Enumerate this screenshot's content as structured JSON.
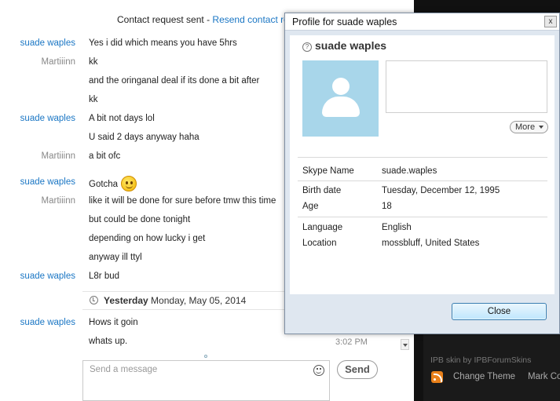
{
  "chat": {
    "notice_text": "Contact request sent - ",
    "notice_link": "Resend contact reque",
    "messages": [
      {
        "sender": "suade waples",
        "text": "Yes i did which means you have 5hrs"
      },
      {
        "sender": "Martiiinn",
        "text": "kk"
      },
      {
        "sender": "",
        "text": "and the oringanal deal if its done a bit after"
      },
      {
        "sender": "",
        "text": "kk"
      },
      {
        "sender": "suade waples",
        "text": "A bit not days lol"
      },
      {
        "sender": "",
        "text": "U said 2 days anyway haha"
      },
      {
        "sender": "Martiiinn",
        "text": "a bit ofc"
      },
      {
        "sender": "suade waples",
        "text": "Gotcha",
        "emoji": "smiley-emoji"
      },
      {
        "sender": "Martiiinn",
        "text": "like it will be done for sure before tmw this time"
      },
      {
        "sender": "",
        "text": "but could be done tonight"
      },
      {
        "sender": "",
        "text": "depending on how lucky i get"
      },
      {
        "sender": "",
        "text": "anyway ill ttyl"
      },
      {
        "sender": "suade waples",
        "text": "L8r bud"
      }
    ],
    "day_separator": {
      "bold": "Yesterday",
      "rest": " Monday, May 05, 2014"
    },
    "messages_after": [
      {
        "sender": "suade waples",
        "text": "Hows it goin"
      },
      {
        "sender": "",
        "text": "whats up."
      }
    ],
    "last_time": "3:02 PM",
    "composer_placeholder": "Send a message",
    "send_label": "Send"
  },
  "footer": {
    "credit": "IPB skin by IPBForumSkins",
    "change_theme": "Change Theme",
    "mark_community": "Mark Co"
  },
  "dialog": {
    "title": "Profile for suade waples",
    "close_x": "x",
    "name": "suade waples",
    "more_label": "More",
    "fields": [
      {
        "key": "Skype Name",
        "value": "suade.waples"
      },
      {
        "key": "Birth date",
        "value": "Tuesday, December 12, 1995"
      },
      {
        "key": "Age",
        "value": "18"
      },
      {
        "key": "Language",
        "value": "English"
      },
      {
        "key": "Location",
        "value": "mossbluff, United States"
      }
    ],
    "close_label": "Close"
  },
  "colors": {
    "link_blue": "#1a76c4",
    "avatar_bg": "#a8d6ea",
    "dark_bg": "#111111"
  }
}
